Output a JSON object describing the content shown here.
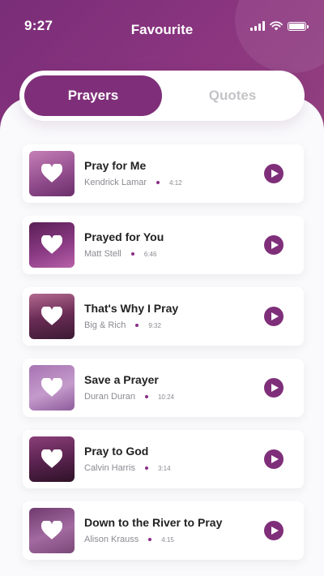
{
  "status_bar": {
    "time": "9:27"
  },
  "header": {
    "title": "Favourite"
  },
  "tabs": [
    {
      "label": "Prayers",
      "active": true
    },
    {
      "label": "Quotes",
      "active": false
    }
  ],
  "colors": {
    "accent": "#7f2f79",
    "header": "#8b357f",
    "dot": "#8b2d86"
  },
  "songs": [
    {
      "title": "Pray for Me",
      "artist": "Kendrick Lamar",
      "duration": "4:12"
    },
    {
      "title": "Prayed for You",
      "artist": "Matt Stell",
      "duration": "6:46"
    },
    {
      "title": "That's Why I Pray",
      "artist": "Big & Rich",
      "duration": "9:32"
    },
    {
      "title": "Save a Prayer",
      "artist": "Duran Duran",
      "duration": "10:24"
    },
    {
      "title": "Pray to God",
      "artist": "Calvin Harris",
      "duration": "3:14"
    },
    {
      "title": "Down to the River to Pray",
      "artist": "Alison Krauss",
      "duration": "4:15"
    }
  ]
}
